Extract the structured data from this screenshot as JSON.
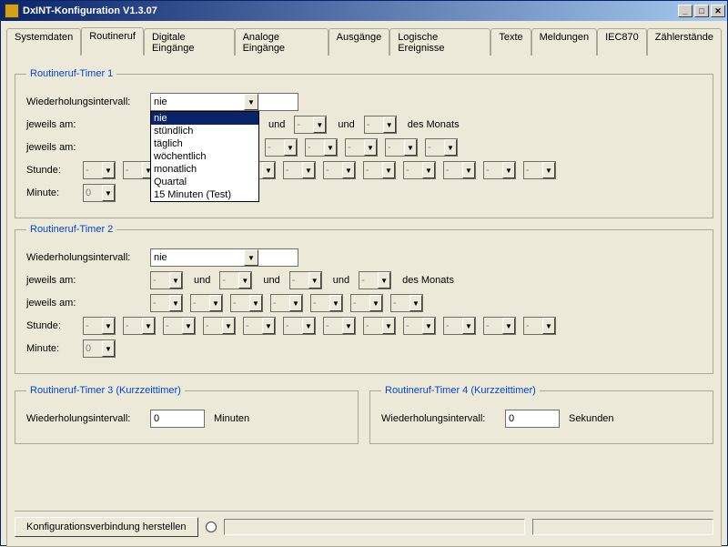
{
  "window": {
    "title": "DxINT-Konfiguration V1.3.07"
  },
  "tabs": [
    "Systemdaten",
    "Routineruf",
    "Digitale Eingänge",
    "Analoge Eingänge",
    "Ausgänge",
    "Logische Ereignisse",
    "Texte",
    "Meldungen",
    "IEC870",
    "Zählerstände"
  ],
  "timer1": {
    "legend": "Routineruf-Timer 1",
    "labels": {
      "intervall": "Wiederholungsintervall:",
      "jeweils_am": "jeweils am:",
      "des_monats": "des Monats",
      "und": "und",
      "stunde": "Stunde:",
      "minute": "Minute:"
    },
    "intervall_value": "nie",
    "intervall_options": [
      "nie",
      "stündlich",
      "täglich",
      "wöchentlich",
      "monatlich",
      "Quartal",
      "15 Minuten (Test)"
    ],
    "placeholder": "-",
    "minute_value": "0"
  },
  "timer2": {
    "legend": "Routineruf-Timer 2",
    "labels": {
      "intervall": "Wiederholungsintervall:",
      "jeweils_am": "jeweils am:",
      "des_monats": "des Monats",
      "und": "und",
      "stunde": "Stunde:",
      "minute": "Minute:"
    },
    "intervall_value": "nie",
    "placeholder": "-",
    "minute_value": "0"
  },
  "timer3": {
    "legend": "Routineruf-Timer 3 (Kurzzeittimer)",
    "label": "Wiederholungsintervall:",
    "value": "0",
    "unit": "Minuten"
  },
  "timer4": {
    "legend": "Routineruf-Timer 4 (Kurzzeittimer)",
    "label": "Wiederholungsintervall:",
    "value": "0",
    "unit": "Sekunden"
  },
  "bottom": {
    "connect_btn": "Konfigurationsverbindung herstellen"
  }
}
